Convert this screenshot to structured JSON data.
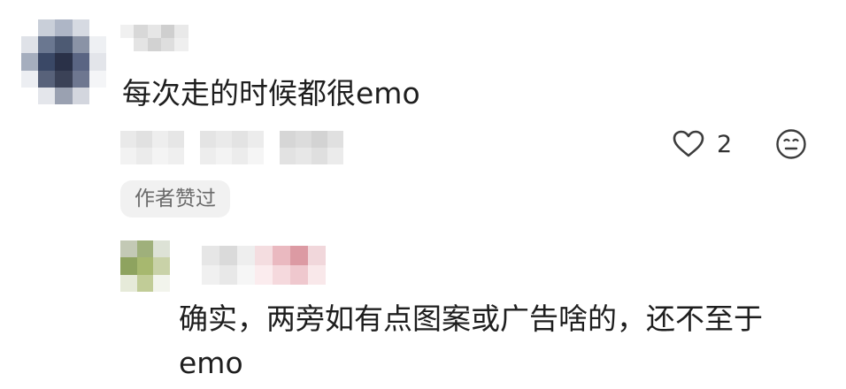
{
  "comment": {
    "text": "每次走的时候都很emo",
    "like_count": "2",
    "author_badge": "作者赞过",
    "icons": {
      "like": "heart-outline-icon",
      "reply": "neutral-face-icon"
    }
  },
  "reply": {
    "text": "确实，两旁如有点图案或广告啥的，还不至于emo"
  },
  "colors": {
    "text_primary": "#1e1e1e",
    "badge_bg": "#f1f1f1",
    "badge_text": "#6a6a6a",
    "icon": "#3c3c3c"
  }
}
